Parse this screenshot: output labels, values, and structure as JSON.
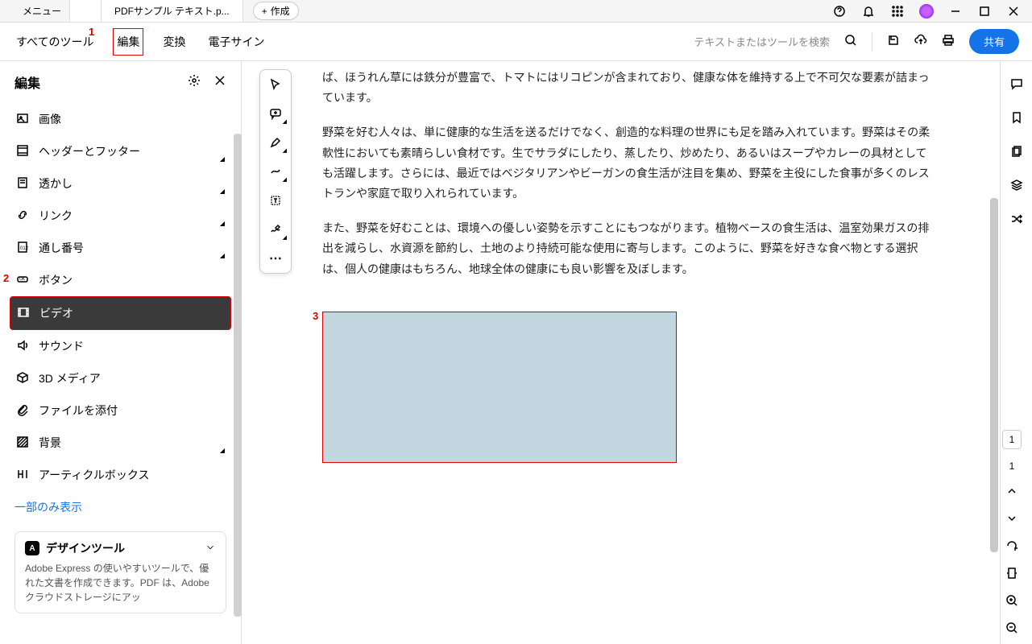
{
  "titlebar": {
    "menu": "メニュー",
    "tab_title": "PDFサンプル テキスト.p...",
    "create": "作成"
  },
  "toolbar": {
    "all_tools": "すべてのツール",
    "edit": "編集",
    "convert": "変換",
    "esign": "電子サイン",
    "search_placeholder": "テキストまたはツールを検索",
    "share": "共有"
  },
  "left_panel": {
    "title": "編集",
    "items": {
      "image": "画像",
      "header_footer": "ヘッダーとフッター",
      "watermark": "透かし",
      "link": "リンク",
      "bates": "通し番号",
      "button": "ボタン",
      "video": "ビデオ",
      "sound": "サウンド",
      "media3d": "3D メディア",
      "attach": "ファイルを添付",
      "background": "背景",
      "article": "アーティクルボックス"
    },
    "show_less": "一部のみ表示",
    "design_title": "デザインツール",
    "design_body": "Adobe Express の使いやすいツールで、優れた文書を作成できます。PDF は、Adobe クラウドストレージにアッ"
  },
  "document": {
    "para1": "ば、ほうれん草には鉄分が豊富で、トマトにはリコピンが含まれており、健康な体を維持する上で不可欠な要素が詰まっています。",
    "para2": "野菜を好む人々は、単に健康的な生活を送るだけでなく、創造的な料理の世界にも足を踏み入れています。野菜はその柔軟性においても素晴らしい食材です。生でサラダにしたり、蒸したり、炒めたり、あるいはスープやカレーの具材としても活躍します。さらには、最近ではベジタリアンやビーガンの食生活が注目を集め、野菜を主役にした食事が多くのレストランや家庭で取り入れられています。",
    "para3": "また、野菜を好むことは、環境への優しい姿勢を示すことにもつながります。植物ベースの食生活は、温室効果ガスの排出を減らし、水資源を節約し、土地のより持続可能な使用に寄与します。このように、野菜を好きな食べ物とする選択は、個人の健康はもちろん、地球全体の健康にも良い影響を及ぼします。"
  },
  "markers": {
    "m1": "1",
    "m2": "2",
    "m3": "3"
  },
  "page_nav": {
    "current": "1",
    "total": "1"
  }
}
